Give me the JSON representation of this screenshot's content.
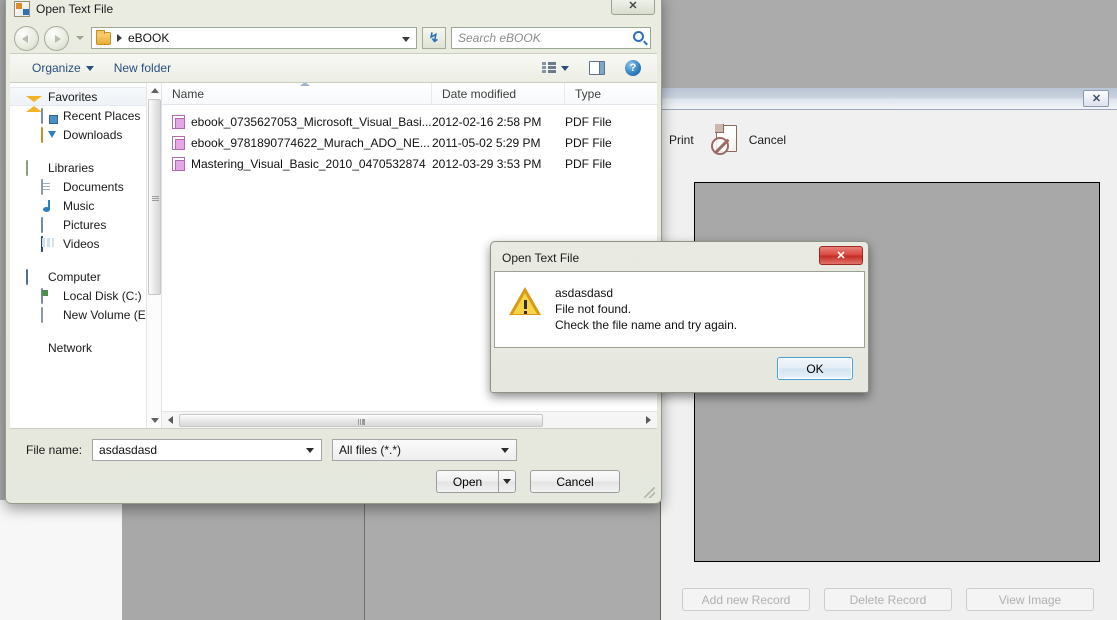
{
  "desktop": {
    "bg_color": "#ababab"
  },
  "file_dialog": {
    "title": "Open Text File",
    "close_label": "✕",
    "address": {
      "crumb": "eBOOK",
      "refresh_label": "↯",
      "search_placeholder": "Search eBOOK"
    },
    "command_bar": {
      "organize_label": "Organize",
      "new_folder_label": "New folder"
    },
    "nav_pane": {
      "groups": [
        {
          "root": {
            "label": "Favorites",
            "icon": "star-icon",
            "selected": true
          },
          "children": [
            {
              "label": "Recent Places",
              "icon": "recent-places-icon"
            },
            {
              "label": "Downloads",
              "icon": "downloads-icon"
            }
          ]
        },
        {
          "root": {
            "label": "Libraries",
            "icon": "libraries-icon",
            "selected": false
          },
          "children": [
            {
              "label": "Documents",
              "icon": "documents-icon"
            },
            {
              "label": "Music",
              "icon": "music-icon"
            },
            {
              "label": "Pictures",
              "icon": "pictures-icon"
            },
            {
              "label": "Videos",
              "icon": "videos-icon"
            }
          ]
        },
        {
          "root": {
            "label": "Computer",
            "icon": "computer-icon",
            "selected": false
          },
          "children": [
            {
              "label": "Local Disk (C:)",
              "icon": "local-disk-icon"
            },
            {
              "label": "New Volume (E:)",
              "icon": "volume-icon"
            }
          ]
        },
        {
          "root": {
            "label": "Network",
            "icon": "network-icon",
            "selected": false
          },
          "children": []
        }
      ]
    },
    "file_list": {
      "columns": [
        "Name",
        "Date modified",
        "Type"
      ],
      "sort_column": "Name",
      "sort_direction": "ascending",
      "rows": [
        {
          "name": "ebook_0735627053_Microsoft_Visual_Basi...",
          "date_modified": "2012-02-16 2:58 PM",
          "type": "PDF File",
          "icon": "pdf-file-icon"
        },
        {
          "name": "ebook_9781890774622_Murach_ADO_NE...",
          "date_modified": "2011-05-02 5:29 PM",
          "type": "PDF File",
          "icon": "pdf-file-icon"
        },
        {
          "name": "Mastering_Visual_Basic_2010_0470532874",
          "date_modified": "2012-03-29 3:53 PM",
          "type": "PDF File",
          "icon": "pdf-file-icon"
        }
      ]
    },
    "footer": {
      "file_name_label": "File name:",
      "file_name_value": "asdasdasd",
      "filter_value": "All files (*.*)",
      "open_label": "Open",
      "cancel_label": "Cancel"
    }
  },
  "message_box": {
    "title": "Open Text File",
    "close_label": "✕",
    "lines": [
      "asdasdasd",
      "File not found.",
      "Check the file name and try again."
    ],
    "ok_label": "OK",
    "icon": "warning-icon"
  },
  "background_window": {
    "close_label": "✕",
    "toolbar": [
      {
        "label": "Print",
        "icon": "print-icon"
      },
      {
        "label": "Cancel",
        "icon": "cancel-document-icon"
      }
    ],
    "buttons": [
      {
        "label": "Add new Record",
        "enabled": false
      },
      {
        "label": "Delete Record",
        "enabled": false
      },
      {
        "label": "View Image",
        "enabled": false
      }
    ]
  }
}
